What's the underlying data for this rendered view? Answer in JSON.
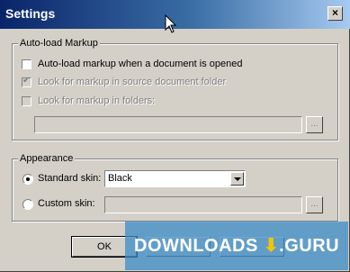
{
  "window": {
    "title": "Settings",
    "close_glyph": "×"
  },
  "autoload": {
    "group_label": "Auto-load Markup",
    "options": [
      {
        "label": "Auto-load markup when a document is opened",
        "checked": false,
        "enabled": true
      },
      {
        "label": "Look for markup in source document folder",
        "checked": true,
        "enabled": false
      },
      {
        "label": "Look for markup in folders:",
        "checked": false,
        "enabled": false
      }
    ],
    "folders_value": "",
    "browse_label": "..."
  },
  "appearance": {
    "group_label": "Appearance",
    "standard_skin_label": "Standard skin:",
    "standard_skin_value": "Black",
    "standard_selected": true,
    "custom_skin_label": "Custom skin:",
    "custom_skin_value": "",
    "browse_label": "..."
  },
  "buttons": {
    "ok": "OK"
  },
  "watermark": {
    "text": "DOWNLOADS",
    "suffix": ".GURU",
    "color": "#3c8cc8"
  }
}
